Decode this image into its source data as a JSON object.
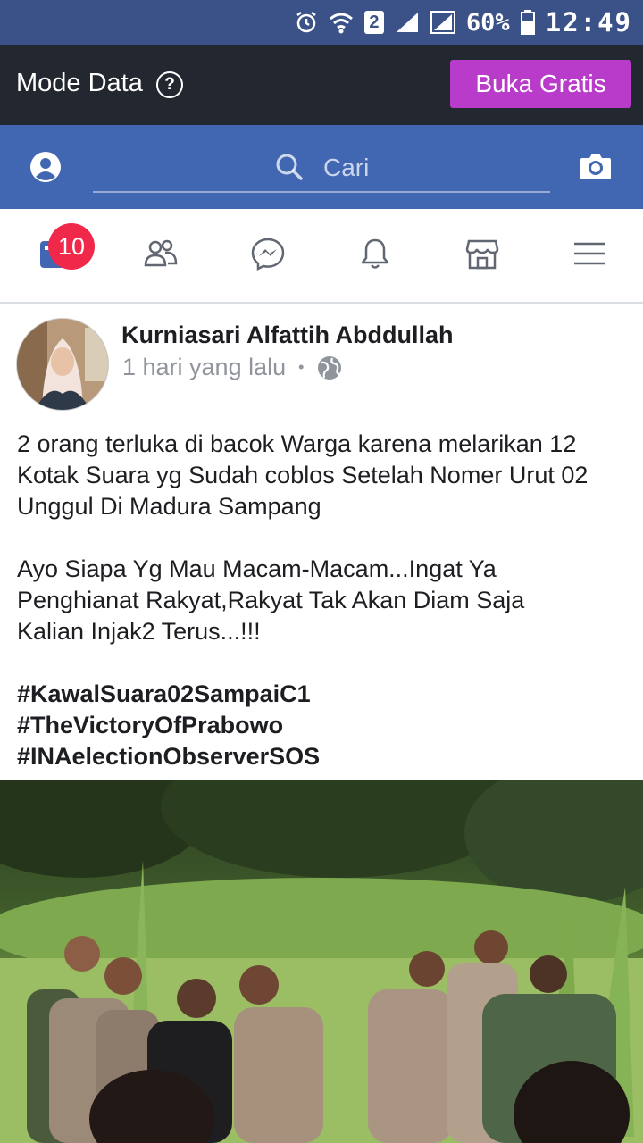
{
  "statusbar": {
    "battery_percent": "60%",
    "time": "12:49",
    "sim_slot": "2"
  },
  "mode_bar": {
    "title": "Mode Data",
    "help_icon": "?",
    "open_free_label": "Buka Gratis"
  },
  "fb_header": {
    "search_placeholder": "Cari"
  },
  "nav": {
    "items": [
      "feed",
      "friends",
      "messenger",
      "notifications",
      "marketplace",
      "menu"
    ],
    "feed_badge": "10"
  },
  "post": {
    "author": "Kurniasari Alfattih Abddullah",
    "time": "1 hari yang lalu",
    "separator": "•",
    "paragraph1": "2 orang terluka di bacok Warga karena melarikan 12 Kotak Suara yg Sudah coblos Setelah Nomer Urut 02 Unggul Di Madura Sampang",
    "paragraph2_line1": "Ayo Siapa Yg Mau Macam-Macam...Ingat Ya",
    "paragraph2_line2": "Penghianat Rakyat,Rakyat Tak Akan Diam Saja",
    "paragraph2_line3": "Kalian Injak2 Terus...!!!",
    "hashtags": [
      "#KawalSuara02SampaiC1",
      "#TheVictoryOfPrabowo",
      "#INAelectionObserverSOS"
    ]
  },
  "colors": {
    "fb_blue": "#4267b2",
    "status_blue": "#3b5289",
    "mode_dark": "#23272f",
    "open_button": "#b93bc9",
    "badge_red": "#f02849"
  }
}
